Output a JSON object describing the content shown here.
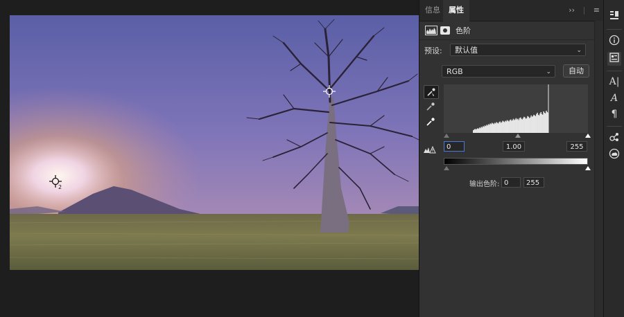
{
  "panel": {
    "tabs": [
      {
        "label": "信息"
      },
      {
        "label": "属性"
      }
    ],
    "tab_controls": {
      "collapse": "››",
      "menu": "≡"
    },
    "adjustment": {
      "title": "色阶"
    },
    "preset": {
      "label": "预设:",
      "value": "默认值"
    },
    "channel": {
      "value": "RGB"
    },
    "auto_button": "自动",
    "input_levels": {
      "black": "0",
      "gamma": "1.00",
      "white": "255"
    },
    "output_levels": {
      "label": "输出色阶:",
      "black": "0",
      "white": "255"
    }
  },
  "histogram": {
    "bins": [
      4,
      5,
      6,
      5,
      6,
      7,
      6,
      8,
      7,
      9,
      8,
      10,
      9,
      11,
      10,
      12,
      11,
      13,
      12,
      14,
      13,
      15,
      14,
      13,
      15,
      14,
      16,
      15,
      14,
      16,
      17,
      15,
      16,
      18,
      17,
      16,
      18,
      17,
      19,
      18,
      17,
      19,
      20,
      18,
      19,
      21,
      19,
      20,
      22,
      20,
      21,
      19,
      22,
      23,
      21,
      20,
      22,
      24,
      23,
      21,
      22,
      25,
      24,
      22,
      23,
      26,
      24,
      25,
      27,
      26,
      25,
      28,
      30,
      27,
      26,
      29,
      31,
      28,
      27,
      32,
      30,
      29,
      33,
      31,
      30
    ]
  },
  "markers": {
    "sampler_2": "2"
  },
  "colors": {
    "panel_bg": "#323232",
    "accent_field": "#4a7ad8",
    "histogram_fill": "#e6e6e6"
  },
  "toolstrip": {
    "icons": [
      "libraries-icon",
      "info-icon",
      "properties-icon",
      "character-icon",
      "glyphs-icon",
      "paragraph-icon",
      "share-icon",
      "creative-cloud-icon"
    ]
  }
}
